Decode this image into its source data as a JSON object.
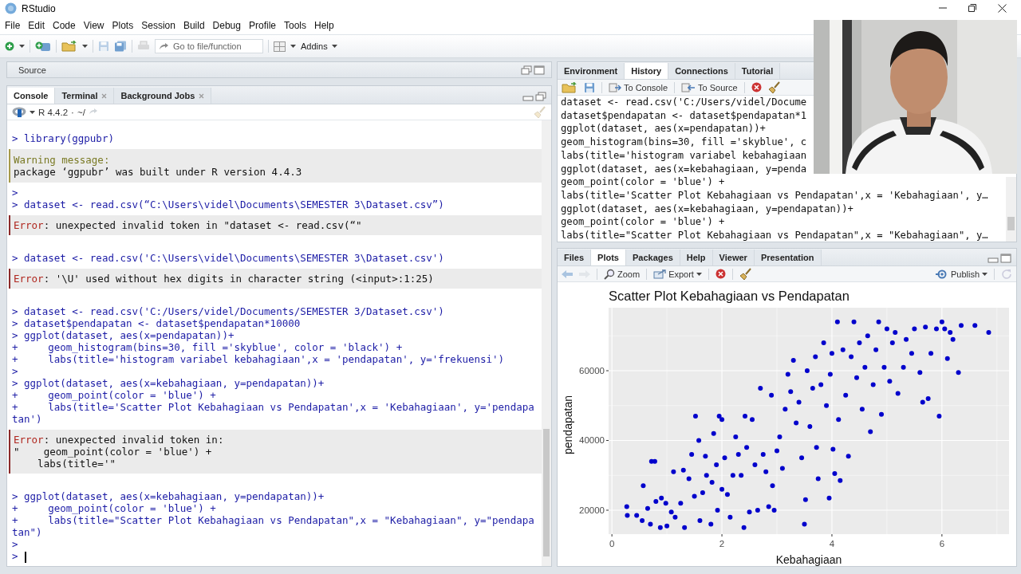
{
  "window": {
    "title": "RStudio"
  },
  "menu": [
    "File",
    "Edit",
    "Code",
    "View",
    "Plots",
    "Session",
    "Build",
    "Debug",
    "Profile",
    "Tools",
    "Help"
  ],
  "toolbar": {
    "search": {
      "placeholder": "Go to file/function"
    },
    "addins": "Addins"
  },
  "source_pane": {
    "title": "Source"
  },
  "console_pane": {
    "tabs": [
      {
        "label": "Console",
        "selected": true,
        "closable": false
      },
      {
        "label": "Terminal",
        "selected": false,
        "closable": true
      },
      {
        "label": "Background Jobs",
        "selected": false,
        "closable": true
      }
    ],
    "version": "R 4.4.2",
    "separator": "·",
    "path": "~/",
    "blocks": [
      {
        "kind": "input",
        "lines": [
          "> library(ggpubr)"
        ]
      },
      {
        "kind": "warning",
        "title": "Warning message:",
        "lines": [
          "package ‘ggpubr’ was built under R version 4.4.3"
        ]
      },
      {
        "kind": "input",
        "lines": [
          ">",
          "> dataset <- read.csv(“C:\\Users\\videl\\Documents\\SEMESTER 3\\Dataset.csv”)"
        ]
      },
      {
        "kind": "error",
        "label": "Error",
        "lines": [
          ": unexpected invalid token in \"dataset <- read.csv(“\""
        ]
      },
      {
        "kind": "input",
        "lines": [
          "> dataset <- read.csv('C:\\Users\\videl\\Documents\\SEMESTER 3\\Dataset.csv')"
        ]
      },
      {
        "kind": "error",
        "label": "Error",
        "lines": [
          ": '\\U' used without hex digits in character string (<input>:1:25)"
        ]
      },
      {
        "kind": "input",
        "lines": [
          "> dataset <- read.csv('C:/Users/videl/Documents/SEMESTER 3/Dataset.csv')",
          "> dataset$pendapatan <- dataset$pendapatan*10000",
          "> ggplot(dataset, aes(x=pendapatan))+",
          "+     geom_histogram(bins=30, fill ='skyblue', color = 'black') +",
          "+     labs(title='histogram variabel kebahagiaan',x = 'pendapatan', y='frekuensi')",
          ">",
          "> ggplot(dataset, aes(x=kebahagiaan, y=pendapatan))+",
          "+     geom_point(color = 'blue') +",
          "+     labs(title='Scatter Plot Kebahagiaan vs Pendapatan',x = 'Kebahagiaan', y='pendapa",
          "tan')"
        ]
      },
      {
        "kind": "error",
        "label": "Error",
        "lines": [
          ": unexpected invalid token in:",
          "\"    geom_point(color = 'blue') +",
          "    labs(title='\""
        ]
      },
      {
        "kind": "input",
        "lines": [
          "> ggplot(dataset, aes(x=kebahagiaan, y=pendapatan))+",
          "+     geom_point(color = 'blue') +",
          "+     labs(title=\"Scatter Plot Kebahagiaan vs Pendapatan\",x = \"Kebahagiaan\", y=\"pendapa",
          "tan\")",
          ">",
          ">"
        ]
      }
    ]
  },
  "environment_pane": {
    "tabs": [
      {
        "label": "Environment",
        "selected": false
      },
      {
        "label": "History",
        "selected": true
      },
      {
        "label": "Connections",
        "selected": false
      },
      {
        "label": "Tutorial",
        "selected": false
      }
    ],
    "buttons": [
      "To Console",
      "To Source"
    ],
    "history": [
      "dataset <- read.csv('C:/Users/videl/Docume",
      "dataset$pendapatan <- dataset$pendapatan*1",
      "ggplot(dataset, aes(x=pendapatan))+",
      "geom_histogram(bins=30, fill ='skyblue', c",
      "labs(title='histogram variabel kebahagiaan",
      "ggplot(dataset, aes(x=kebahagiaan, y=penda",
      "geom_point(color = 'blue') +",
      "labs(title='Scatter Plot Kebahagiaan vs Pendapatan',x = 'Kebahagiaan', y…",
      "ggplot(dataset, aes(x=kebahagiaan, y=pendapatan))+",
      "geom_point(color = 'blue') +",
      "labs(title=\"Scatter Plot Kebahagiaan vs Pendapatan\",x = \"Kebahagiaan\", y…"
    ]
  },
  "plots_pane": {
    "tabs": [
      {
        "label": "Files",
        "selected": false
      },
      {
        "label": "Plots",
        "selected": true
      },
      {
        "label": "Packages",
        "selected": false
      },
      {
        "label": "Help",
        "selected": false
      },
      {
        "label": "Viewer",
        "selected": false
      },
      {
        "label": "Presentation",
        "selected": false
      }
    ],
    "buttons": [
      {
        "label": "Zoom",
        "kind": "zoom"
      },
      {
        "label": "Export",
        "kind": "export"
      }
    ],
    "publish": "Publish",
    "chart_data": {
      "type": "scatter",
      "title": "Scatter Plot Kebahagiaan vs Pendapatan",
      "xlabel": "Kebahagiaan",
      "ylabel": "pendapatan",
      "xlim": [
        -0.06,
        7.22
      ],
      "ylim": [
        13140,
        78060
      ],
      "xticks": [
        0,
        2,
        4,
        6
      ],
      "yticks": [
        20000,
        40000,
        60000
      ],
      "grid": true,
      "x": [
        0.27,
        0.28,
        0.45,
        0.55,
        0.57,
        0.65,
        0.7,
        0.72,
        0.78,
        0.8,
        0.88,
        0.9,
        0.98,
        1.0,
        1.08,
        1.12,
        1.15,
        1.25,
        1.3,
        1.32,
        1.4,
        1.45,
        1.5,
        1.52,
        1.58,
        1.6,
        1.65,
        1.7,
        1.72,
        1.8,
        1.82,
        1.85,
        1.9,
        1.92,
        1.95,
        2.0,
        2.0,
        2.05,
        2.1,
        2.15,
        2.2,
        2.25,
        2.3,
        2.35,
        2.4,
        2.42,
        2.45,
        2.5,
        2.55,
        2.6,
        2.65,
        2.7,
        2.75,
        2.8,
        2.85,
        2.9,
        2.92,
        2.95,
        3.0,
        3.05,
        3.1,
        3.15,
        3.2,
        3.25,
        3.3,
        3.35,
        3.4,
        3.45,
        3.5,
        3.52,
        3.55,
        3.6,
        3.65,
        3.7,
        3.72,
        3.75,
        3.8,
        3.85,
        3.9,
        3.95,
        3.97,
        4.0,
        4.02,
        4.05,
        4.1,
        4.12,
        4.15,
        4.2,
        4.25,
        4.3,
        4.35,
        4.4,
        4.45,
        4.5,
        4.55,
        4.6,
        4.65,
        4.7,
        4.75,
        4.8,
        4.85,
        4.9,
        4.95,
        5.0,
        5.05,
        5.1,
        5.15,
        5.2,
        5.3,
        5.35,
        5.45,
        5.5,
        5.6,
        5.65,
        5.7,
        5.75,
        5.8,
        5.9,
        5.95,
        6.0,
        6.05,
        6.1,
        6.15,
        6.2,
        6.3,
        6.35,
        6.6,
        6.85
      ],
      "series": [
        {
          "color": "#0000cc",
          "values": [
            21000,
            18500,
            18500,
            17000,
            27000,
            20500,
            16000,
            34000,
            34000,
            22500,
            15000,
            23500,
            22000,
            15500,
            19500,
            31000,
            18000,
            22000,
            31500,
            15000,
            29000,
            36000,
            24000,
            47000,
            40000,
            17000,
            25000,
            35500,
            30000,
            16000,
            28000,
            42000,
            33000,
            20000,
            47000,
            46000,
            26000,
            35000,
            24500,
            18000,
            30000,
            41000,
            36000,
            30000,
            15000,
            47000,
            38000,
            19500,
            46000,
            33000,
            20000,
            55000,
            36000,
            31000,
            21000,
            53000,
            27000,
            20000,
            37000,
            41000,
            32000,
            49000,
            59000,
            54000,
            63000,
            45000,
            51000,
            35000,
            16000,
            23000,
            60000,
            44000,
            55000,
            64000,
            38000,
            29000,
            56000,
            68000,
            50000,
            23500,
            59000,
            65000,
            37500,
            30500,
            74000,
            46000,
            28500,
            66000,
            53000,
            35500,
            64000,
            74000,
            58000,
            68000,
            49000,
            61000,
            70000,
            42500,
            56000,
            66000,
            74000,
            47500,
            61000,
            72000,
            57000,
            68000,
            71000,
            53500,
            61000,
            69000,
            65000,
            72000,
            59500,
            51000,
            72500,
            52000,
            65000,
            72000,
            47000,
            74000,
            72000,
            63500,
            71000,
            69000,
            59500,
            73000,
            73000,
            71000
          ]
        }
      ]
    }
  }
}
